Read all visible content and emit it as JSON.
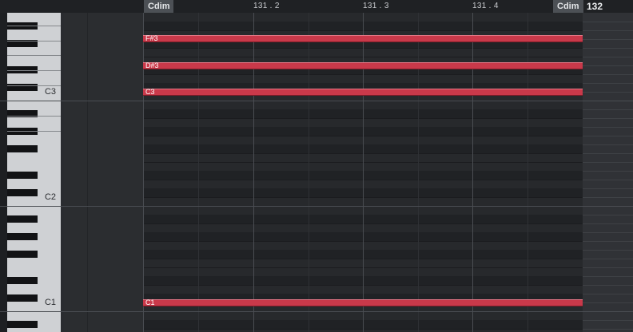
{
  "ruler": {
    "chord_start": "Cdim",
    "chord_end": "Cdim",
    "bar_positions": [
      "131 . 2",
      "131 . 3",
      "131 . 4"
    ],
    "next_bar": "132"
  },
  "keyboard": {
    "labels": [
      "C3",
      "C2",
      "C1"
    ]
  },
  "notes": [
    "F#3",
    "D#3",
    "C3",
    "C1"
  ],
  "colors": {
    "note": "#c9394a",
    "grid_bg": "#27292c",
    "ruler_bg": "#1f2124"
  }
}
